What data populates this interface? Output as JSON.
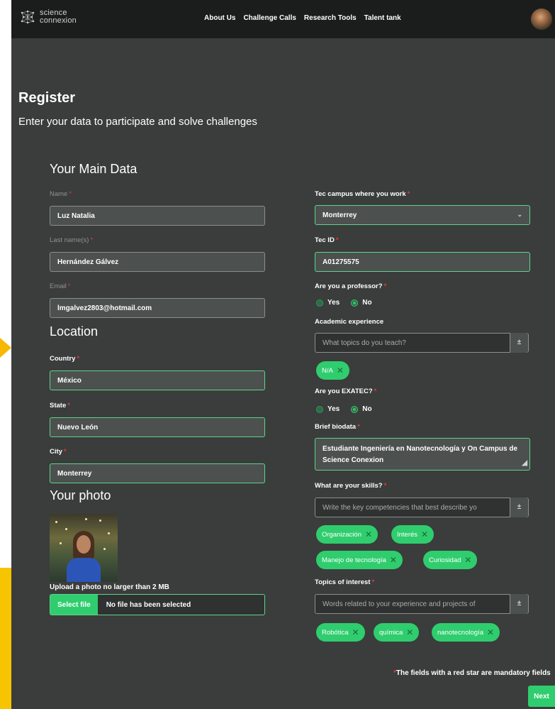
{
  "nav": {
    "logo_line1": "science",
    "logo_line2": "connexion",
    "links": [
      "About Us",
      "Challenge Calls",
      "Research Tools",
      "Talent tank"
    ]
  },
  "page": {
    "title": "Register",
    "subtitle": "Enter your data to participate and solve challenges"
  },
  "main_data": {
    "heading": "Your Main Data",
    "name_label": "Name",
    "name_value": "Luz Natalia",
    "lastname_label": "Last name(s)",
    "lastname_value": "Hernández Gálvez",
    "email_label": "Email",
    "email_value": "lmgalvez2803@hotmail.com"
  },
  "location": {
    "heading": "Location",
    "country_label": "Country",
    "country_value": "México",
    "state_label": "State",
    "state_value": "Nuevo León",
    "city_label": "City",
    "city_value": "Monterrey"
  },
  "photo": {
    "heading": "Your photo",
    "note": "Upload a photo no larger than 2 MB",
    "select_label": "Select file",
    "file_status": "No file has been selected"
  },
  "right": {
    "campus_label": "Tec campus where you work",
    "campus_value": "Monterrey",
    "tecid_label": "Tec ID",
    "tecid_value": "A01275575",
    "professor_label": "Are you a professor?",
    "professor_yes": "Yes",
    "professor_no": "No",
    "professor_selected": "No",
    "academic_label": "Academic experience",
    "academic_placeholder": "What topics do you teach?",
    "academic_tags": [
      "N/A"
    ],
    "exatec_label": "Are you EXATEC?",
    "exatec_yes": "Yes",
    "exatec_no": "No",
    "exatec_selected": "No",
    "bio_label": "Brief biodata",
    "bio_value": "Estudiante Ingeniería en Nanotecnología y On Campus de Science Conexion",
    "skills_label": "What are your skills?",
    "skills_placeholder": "Write the key competencies that best describe yo",
    "skills_tags": [
      "Organización",
      "Interés",
      "Manejo de tecnología",
      "Curiosidad"
    ],
    "topics_label": "Topics of interest",
    "topics_placeholder": "Words related to your experience and projects of",
    "topics_tags": [
      "Robótica",
      "química",
      "nanotecnología"
    ],
    "plusminus": "±"
  },
  "footer": {
    "mandatory_note": "The fields with a red star are mandatory fields",
    "next_label": "Next"
  },
  "colors": {
    "accent": "#2fcd6e",
    "background": "#3a3d3c",
    "navbar": "#1b1d1c",
    "required_star": "#e03b3b"
  }
}
